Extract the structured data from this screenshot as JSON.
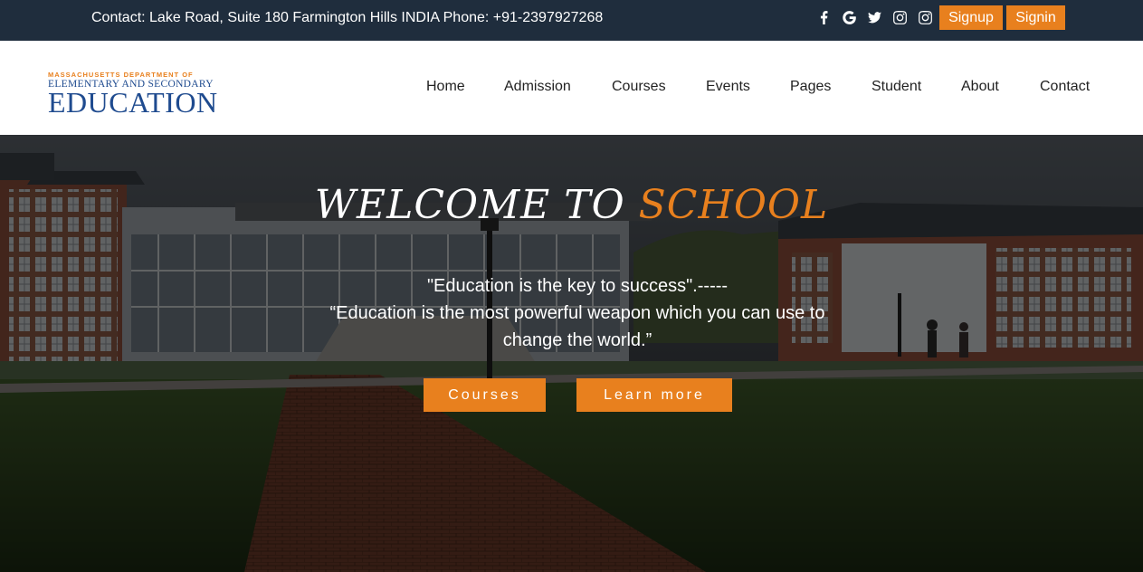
{
  "topbar": {
    "contact": "Contact: Lake Road, Suite 180 Farmington Hills INDIA Phone: +91-2397927268",
    "socials": [
      "facebook-icon",
      "google-icon",
      "twitter-icon",
      "instagram-icon",
      "instagram-icon"
    ],
    "signup_label": "Signup",
    "signin_label": "Signin"
  },
  "logo": {
    "line1": "MASSACHUSETTS DEPARTMENT OF",
    "line2": "ELEMENTARY AND SECONDARY",
    "line3": "EDUCATION"
  },
  "nav": {
    "items": [
      "Home",
      "Admission",
      "Courses",
      "Events",
      "Pages",
      "Student",
      "About",
      "Contact"
    ]
  },
  "hero": {
    "title_white": "WELCOME TO ",
    "title_accent": "SCHOOL",
    "quote_line1": "\"Education is the key to success\".-----",
    "quote_line2": "“Education is the most powerful weapon which you can use to change the world.”",
    "courses_label": "Courses",
    "learn_label": "Learn more"
  },
  "colors": {
    "accent": "#e8801e",
    "topbar_bg": "#1f2d3d",
    "logo_blue": "#1f4b8f"
  }
}
